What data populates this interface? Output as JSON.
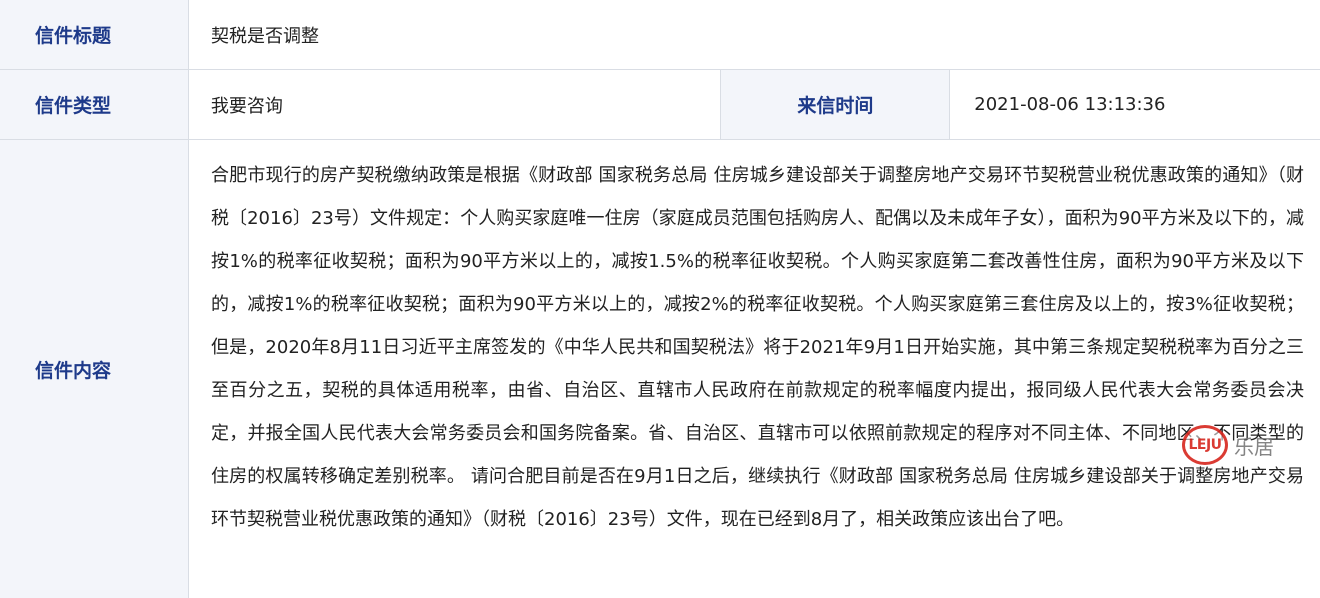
{
  "rows": {
    "title_label": "信件标题",
    "title_value": "契税是否调整",
    "type_label": "信件类型",
    "type_value": "我要咨询",
    "time_label": "来信时间",
    "time_value": "2021-08-06 13:13:36",
    "content_label": "信件内容",
    "content_value": "合肥市现行的房产契税缴纳政策是根据《财政部 国家税务总局 住房城乡建设部关于调整房地产交易环节契税营业税优惠政策的通知》（财税〔2016〕23号）文件规定：个人购买家庭唯一住房（家庭成员范围包括购房人、配偶以及未成年子女），面积为90平方米及以下的，减按1%的税率征收契税；面积为90平方米以上的，减按1.5%的税率征收契税。个人购买家庭第二套改善性住房，面积为90平方米及以下的，减按1%的税率征收契税；面积为90平方米以上的，减按2%的税率征收契税。个人购买家庭第三套住房及以上的，按3%征收契税；但是，2020年8月11日习近平主席签发的《中华人民共和国契税法》将于2021年9月1日开始实施，其中第三条规定契税税率为百分之三至百分之五，契税的具体适用税率，由省、自治区、直辖市人民政府在前款规定的税率幅度内提出，报同级人民代表大会常务委员会决定，并报全国人民代表大会常务委员会和国务院备案。省、自治区、直辖市可以依照前款规定的程序对不同主体、不同地区、不同类型的住房的权属转移确定差别税率。 请问合肥目前是否在9月1日之后，继续执行《财政部 国家税务总局 住房城乡建设部关于调整房地产交易环节契税营业税优惠政策的通知》（财税〔2016〕23号）文件，现在已经到8月了，相关政策应该出台了吧。"
  },
  "watermark": {
    "brand_en": "LEJU",
    "brand_cn": "乐居"
  },
  "colors": {
    "label_text": "#1e3a8a",
    "label_bg": "#f3f5fa",
    "border": "#d9dde4",
    "watermark_red": "#d7261e"
  }
}
